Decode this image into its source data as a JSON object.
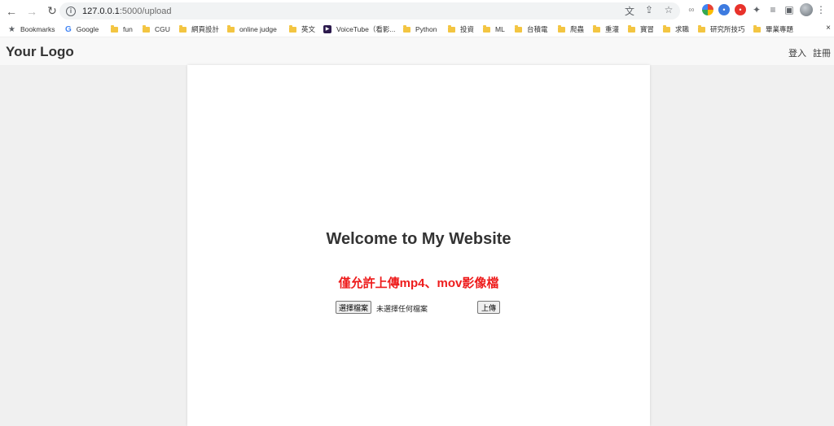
{
  "browser": {
    "url_host": "127.0.0.1",
    "url_path": ":5000/upload",
    "bookmarks": [
      {
        "label": "Bookmarks",
        "icon": "star"
      },
      {
        "label": "Google",
        "icon": "google"
      },
      {
        "label": "fun",
        "icon": "folder"
      },
      {
        "label": "CGU",
        "icon": "folder"
      },
      {
        "label": "網頁設計",
        "icon": "folder"
      },
      {
        "label": "online judge",
        "icon": "folder"
      },
      {
        "label": "英文",
        "icon": "folder"
      },
      {
        "label": "VoiceTube（看影...",
        "icon": "voicetube"
      },
      {
        "label": "Python",
        "icon": "folder"
      },
      {
        "label": "投資",
        "icon": "folder"
      },
      {
        "label": "ML",
        "icon": "folder"
      },
      {
        "label": "台積電",
        "icon": "folder"
      },
      {
        "label": "爬蟲",
        "icon": "folder"
      },
      {
        "label": "重灌",
        "icon": "folder"
      },
      {
        "label": "寶冒",
        "icon": "folder"
      },
      {
        "label": "求職",
        "icon": "folder"
      },
      {
        "label": "研究所技巧",
        "icon": "folder"
      },
      {
        "label": "畢業專題",
        "icon": "folder"
      }
    ],
    "close_glyph": "×"
  },
  "site": {
    "logo": "Your Logo",
    "login": "登入",
    "register": "註冊"
  },
  "main": {
    "welcome": "Welcome to My Website",
    "notice": "僅允許上傳mp4、mov影像檔",
    "choose_file_label": "選擇檔案",
    "file_status": "未選擇任何檔案",
    "upload_label": "上傳"
  },
  "colors": {
    "notice_red": "#ee1c1c",
    "page_bg": "#f0f0f0",
    "header_bg": "#f8f8f8"
  }
}
